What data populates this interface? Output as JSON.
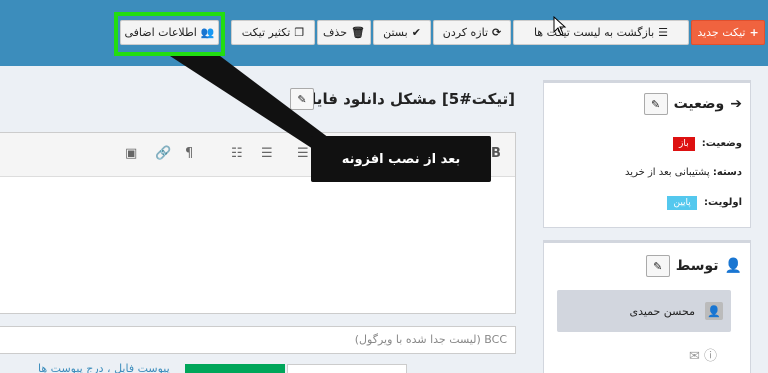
{
  "toolbar": {
    "new_ticket": "تیکت جدید",
    "back_to_list": "بازگشت به لیست تیکت ها",
    "refresh": "تازه کردن",
    "close": "بستن",
    "delete": "حذف",
    "duplicate": "تکثیر تیکت",
    "extra_info": "اطلاعات اضافی"
  },
  "ticket": {
    "title": "[تیکت#5] مشکل دانلود فایل"
  },
  "editor": {
    "bcc_placeholder": "BCC (لیست جدا شده با ویرگول)",
    "bottom_link": "پیوست فایل ، درج پیوست ها"
  },
  "status_box": {
    "heading": "وضعیت",
    "status_label": "وضعیت:",
    "status_value": "باز",
    "category_label": "دسته:",
    "category_value": "پشتیبانی بعد از خرید",
    "priority_label": "اولویت:",
    "priority_value": "پایین"
  },
  "by_box": {
    "heading": "توسط",
    "user_name": "محسن حمیدی"
  },
  "annotation": {
    "callout": "بعد از نصب افزونه"
  },
  "colors": {
    "brand": "#3c8dbc",
    "accent_new": "#f0633f",
    "highlight": "#22dd11",
    "status_open": "#dd1111",
    "priority_low": "#54c8ee"
  },
  "icons": [
    "plus-icon",
    "list-icon",
    "refresh-icon",
    "check-icon",
    "trash-icon",
    "copy-icon",
    "users-icon",
    "edit-icon",
    "arrow-circle-icon",
    "user-icon",
    "envelope-icon",
    "info-icon",
    "cursor-icon"
  ]
}
